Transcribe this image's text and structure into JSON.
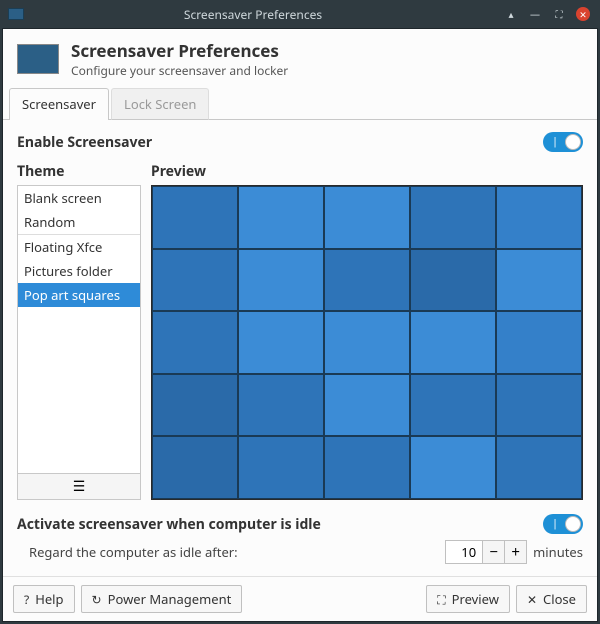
{
  "titlebar": {
    "title": "Screensaver Preferences"
  },
  "header": {
    "title": "Screensaver Preferences",
    "subtitle": "Configure your screensaver and locker"
  },
  "tabs": {
    "screensaver": "Screensaver",
    "lockscreen": "Lock Screen"
  },
  "enable": {
    "label": "Enable Screensaver",
    "on": true
  },
  "theme": {
    "label": "Theme",
    "items": [
      "Blank screen",
      "Random",
      "Floating Xfce",
      "Pictures folder",
      "Pop art squares"
    ],
    "selected_index": 4
  },
  "preview": {
    "label": "Preview",
    "cell_colors": [
      "#2e74b8",
      "#3c8cd6",
      "#3c8cd6",
      "#2e74b8",
      "#3480c9",
      "#2e74b8",
      "#3c8cd6",
      "#2e74b8",
      "#2a6aa9",
      "#3c8cd6",
      "#2e74b8",
      "#3c8cd6",
      "#3c8cd6",
      "#3c8cd6",
      "#3480c9",
      "#2a6aa9",
      "#2e74b8",
      "#3c8cd6",
      "#2e74b8",
      "#2e74b8",
      "#2a6aa9",
      "#2e74b8",
      "#2e74b8",
      "#3c8cd6",
      "#2e74b8"
    ]
  },
  "idle": {
    "label": "Activate screensaver when computer is idle",
    "on": true,
    "regard": "Regard the computer as idle after:",
    "value": 10,
    "unit": "minutes"
  },
  "footer": {
    "help": "Help",
    "power": "Power Management",
    "preview": "Preview",
    "close": "Close"
  }
}
